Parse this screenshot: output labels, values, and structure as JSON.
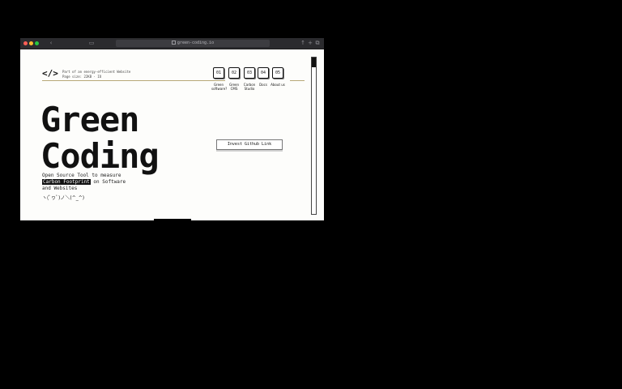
{
  "browser": {
    "url": "green-coding.io"
  },
  "page": {
    "logo": "</>",
    "tagline": [
      "Part of an energy-efficient Website",
      "Page size: 22KB · IO"
    ],
    "nav": [
      {
        "num": "01",
        "label": "Green software?"
      },
      {
        "num": "02",
        "label": "Green CMS"
      },
      {
        "num": "03",
        "label": "Carbon Studio"
      },
      {
        "num": "04",
        "label": "Docs"
      },
      {
        "num": "05",
        "label": "About us"
      }
    ],
    "hero_line1": "Green",
    "hero_line2": "Coding",
    "sub_line1": "Open Source Tool to measure",
    "sub_highlight": "Carbon Footprint",
    "sub_line2_rest": " on Software",
    "sub_line3": "and Websites",
    "kaomoji": "ヽ(ﾟヮﾟ)ノ＼(^_^)",
    "cta_label": "Invest Github Link"
  }
}
